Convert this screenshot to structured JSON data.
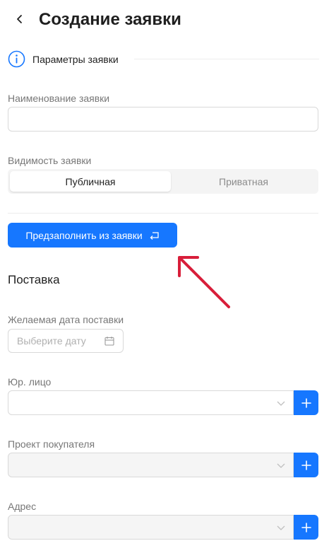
{
  "header": {
    "title": "Создание заявки",
    "back_icon": "chevron-left-icon"
  },
  "section": {
    "title": "Параметры заявки",
    "icon": "info-icon"
  },
  "request_name": {
    "label": "Наименование заявки",
    "value": "",
    "placeholder": ""
  },
  "visibility": {
    "label": "Видимость заявки",
    "options": [
      "Публичная",
      "Приватная"
    ],
    "selected": "Публичная"
  },
  "prefill_button": {
    "label": "Предзаполнить из заявки",
    "icon": "return-arrow-icon"
  },
  "delivery": {
    "heading": "Поставка",
    "date": {
      "label": "Желаемая дата поставки",
      "placeholder": "Выберите дату",
      "icon": "calendar-icon"
    },
    "legal_entity": {
      "label": "Юр. лицо",
      "value": ""
    },
    "buyer_project": {
      "label": "Проект покупателя",
      "value": ""
    },
    "address": {
      "label": "Адрес",
      "value": ""
    }
  },
  "colors": {
    "accent": "#1677ff",
    "annotation_arrow": "#d81e3a"
  }
}
